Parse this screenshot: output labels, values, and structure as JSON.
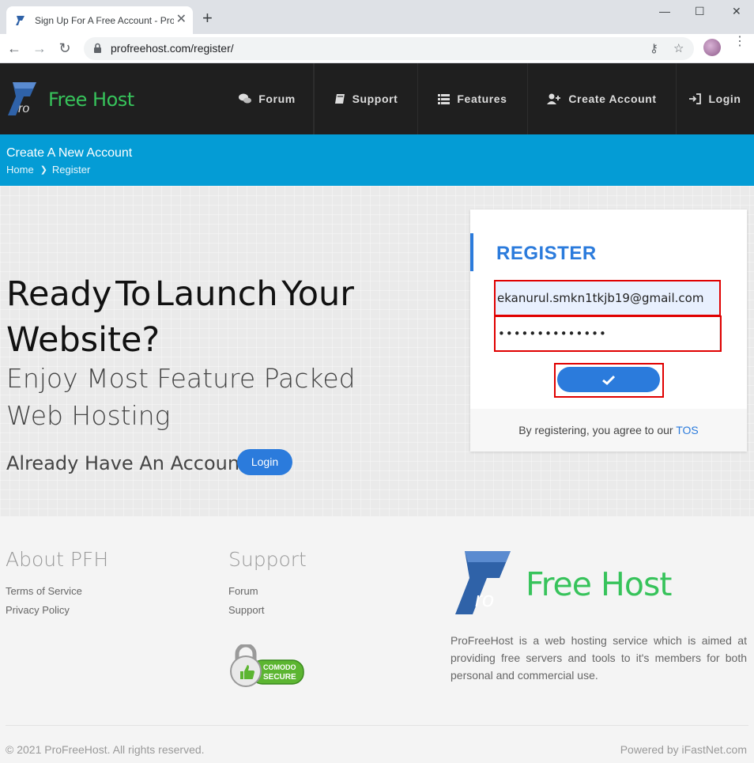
{
  "browser": {
    "tab_title": "Sign Up For A Free Account - Pro",
    "url": "profreehost.com/register/"
  },
  "header": {
    "logo_text": "Free Host",
    "nav": [
      {
        "label": "Forum",
        "icon": "comments-icon"
      },
      {
        "label": "Support",
        "icon": "book-icon"
      },
      {
        "label": "Features",
        "icon": "list-icon"
      },
      {
        "label": "Create Account",
        "icon": "user-plus-icon"
      },
      {
        "label": "Login",
        "icon": "sign-in-icon"
      }
    ]
  },
  "banner": {
    "title": "Create A New Account",
    "breadcrumb": [
      "Home",
      "Register"
    ]
  },
  "hero": {
    "headline_line1": [
      "Ready",
      "To",
      "Launch",
      "Your"
    ],
    "headline_line2": "Website?",
    "subheadline": "Enjoy Most Feature Packed Web Hosting",
    "already_text": "Already Have An Account!",
    "login_label": "Login"
  },
  "register": {
    "title": "REGISTER",
    "email_value": "ekanurul.smkn1tkjb19@gmail.com",
    "password_value": "••••••••••••••",
    "submit_icon": "check-icon",
    "agree_text": "By registering, you agree to our ",
    "tos_link": "TOS"
  },
  "footer": {
    "about_heading": "About PFH",
    "about_links": [
      "Terms of Service",
      "Privacy Policy"
    ],
    "support_heading": "Support",
    "support_links": [
      "Forum",
      "Support"
    ],
    "comodo_top": "COMODO",
    "comodo_bottom": "SECURE",
    "logo_text": "Free Host",
    "description": "ProFreeHost is a web hosting service which is aimed at providing free servers and tools to it's members for both personal and commercial use.",
    "copyright": "© 2021 ProFreeHost. All rights reserved.",
    "powered_by": "Powered by iFastNet.com"
  },
  "colors": {
    "accent_blue": "#2b7bdc",
    "banner_blue": "#049cd5",
    "brand_green": "#37c35b",
    "highlight_red": "#e00000"
  }
}
